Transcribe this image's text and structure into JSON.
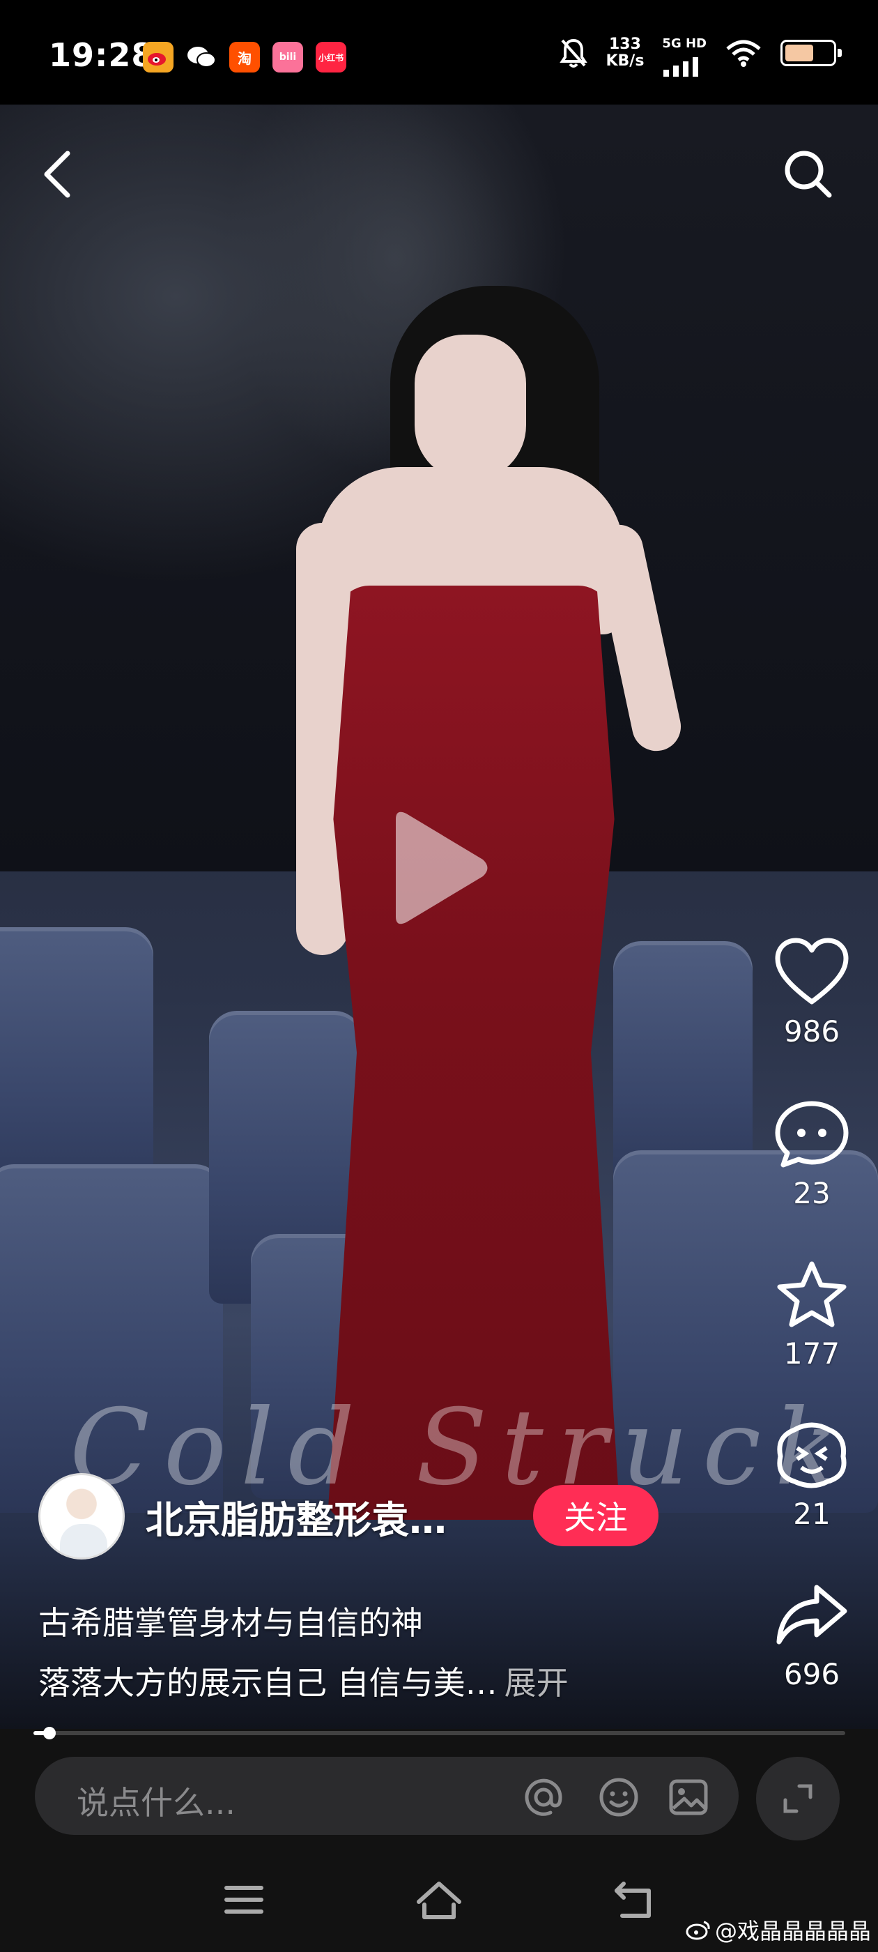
{
  "status_bar": {
    "time": "19:28",
    "app_icons": [
      {
        "name": "weibo-icon",
        "label": "",
        "color": "#f5a623"
      },
      {
        "name": "wechat-icon",
        "label": "",
        "color": "#ffffff"
      },
      {
        "name": "taobao-icon",
        "label": "淘",
        "color": "#ff5000"
      },
      {
        "name": "bilibili-icon",
        "label": "bili",
        "color": "#fb7299"
      },
      {
        "name": "xiaohongshu-icon",
        "label": "小红书",
        "color": "#ff2442"
      }
    ],
    "net_speed_value": "133",
    "net_speed_unit": "KB/s",
    "signal_label": "5G HD",
    "battery_level": 0.6,
    "battery_color": "#f5c8a3"
  },
  "video": {
    "overlay_text": "Cold Struck",
    "play_icon": "play-icon"
  },
  "nav": {
    "back_icon": "back-arrow-icon",
    "search_icon": "search-icon"
  },
  "actions": {
    "like_count": "986",
    "comment_count": "23",
    "favorite_count": "177",
    "emoji_count": "21",
    "share_count": "696"
  },
  "author": {
    "name": "北京脂肪整形袁…",
    "follow_label": "关注",
    "follow_color": "#ff2d55"
  },
  "description": {
    "line1": "古希腊掌管身材与自信的神",
    "line2": "落落大方的展示自己 自信与美…",
    "expand_label": "展开"
  },
  "progress": 0.02,
  "comment_bar": {
    "placeholder": "说点什么..."
  },
  "watermark": "@戏晶晶晶晶晶"
}
